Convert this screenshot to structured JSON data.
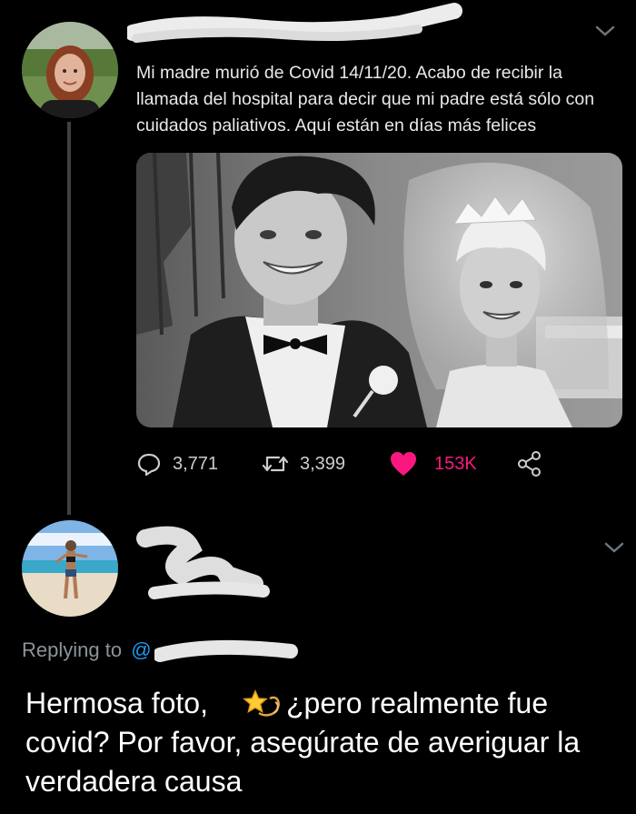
{
  "tweet": {
    "text": "Mi madre murió de Covid 14/11/20. Acabo de recibir la llamada del hospital para decir que mi padre está sólo con cuidados paliativos. Aquí están en días más felices",
    "avatar_icon": "user-avatar-photo",
    "stats": {
      "replies": "3,771",
      "retweets": "3,399",
      "likes": "153K"
    },
    "like_color": "#f91880"
  },
  "reply": {
    "replying_to_label": "Replying to",
    "handle_mention": "@",
    "text_before_emoji": "Hermosa foto,",
    "emoji_icon": "shooting-star-icon",
    "text_after_emoji": "¿pero realmente fue covid? Por favor, asegúrate de averiguar la verdadera causa"
  },
  "theme": {
    "background": "#000000",
    "text": "#e7e9ea",
    "secondary_text": "#8b949a",
    "thread_line": "#3d4144"
  }
}
